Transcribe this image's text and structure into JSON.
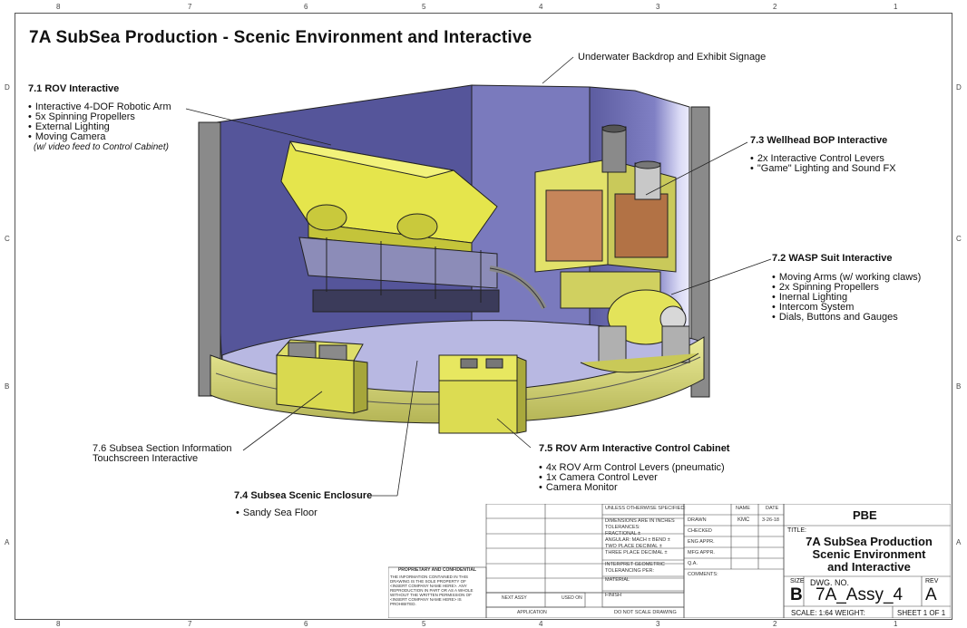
{
  "border": {
    "top_numbers": [
      "8",
      "7",
      "6",
      "5",
      "4",
      "3",
      "2",
      "1"
    ],
    "bottom_numbers": [
      "8",
      "7",
      "6",
      "5",
      "4",
      "3",
      "2",
      "1"
    ],
    "side_letters": [
      "D",
      "C",
      "B",
      "A"
    ]
  },
  "title": "7A SubSea Production - Scenic Environment and Interactive",
  "callouts": {
    "backdrop": {
      "label": "Underwater Backdrop and Exhibit Signage"
    },
    "rov": {
      "heading": "7.1  ROV Interactive",
      "items": [
        "Interactive 4-DOF Robotic Arm",
        "5x Spinning Propellers",
        "External Lighting",
        "Moving Camera"
      ],
      "note": "(w/ video feed to Control Cabinet)"
    },
    "wellhead": {
      "heading": "7.3  Wellhead BOP Interactive",
      "items": [
        "2x Interactive Control Levers",
        "\"Game\" Lighting and Sound FX"
      ]
    },
    "wasp": {
      "heading": "7.2  WASP Suit Interactive",
      "items": [
        "Moving Arms (w/ working claws)",
        "2x Spinning Propellers",
        "Inernal Lighting",
        "Intercom System",
        "Dials, Buttons and Gauges"
      ]
    },
    "touchscreen": {
      "line1": "7.6  Subsea Section Information",
      "line2": "Touchscreen Interactive"
    },
    "cabinet": {
      "heading": "7.5  ROV Arm Interactive Control Cabinet",
      "items": [
        "4x ROV Arm Control Levers (pneumatic)",
        "1x Camera Control Lever",
        "Camera Monitor"
      ]
    },
    "enclosure": {
      "heading": "7.4  Subsea Scenic Enclosure",
      "items": [
        "Sandy Sea Floor"
      ]
    }
  },
  "title_block": {
    "company": "PBE",
    "title_label": "TITLE:",
    "title_lines": [
      "7A SubSea Production",
      "Scenic Environment",
      "and Interactive"
    ],
    "size_label": "SIZE",
    "size": "B",
    "dwg_no_label": "DWG.  NO.",
    "dwg_no": "7A_Assy_4",
    "rev_label": "REV",
    "rev": "A",
    "scale": "SCALE: 1:64 WEIGHT:",
    "sheet": "SHEET 1 OF 1",
    "unless": "UNLESS OTHERWISE SPECIFIED:",
    "name_label": "NAME",
    "date_label": "DATE",
    "drawn_label": "DRAWN",
    "drawn_name": "KMC",
    "drawn_date": "3-26-18",
    "checked": "CHECKED",
    "eng_appr": "ENG APPR.",
    "mfg_appr": "MFG APPR.",
    "qa": "Q.A.",
    "comments": "COMMENTS:",
    "tolerances": [
      "DIMENSIONS ARE IN INCHES",
      "TOLERANCES:",
      "FRACTIONAL ±",
      "ANGULAR: MACH ±    BEND ±",
      "TWO PLACE DECIMAL    ±",
      "THREE PLACE DECIMAL  ±"
    ],
    "interpret": [
      "INTERPRET GEOMETRIC",
      "TOLERANCING PER:"
    ],
    "material": "MATERIAL",
    "finish": "FINISH",
    "next_assy": "NEXT ASSY",
    "used_on": "USED ON",
    "application": "APPLICATION",
    "do_not_scale": "DO NOT SCALE DRAWING",
    "proprietary_heading": "PROPRIETARY AND CONFIDENTIAL",
    "proprietary_text": [
      "THE INFORMATION CONTAINED IN THIS",
      "DRAWING IS THE SOLE PROPERTY OF",
      "<INSERT COMPANY NAME HERE>.  ANY",
      "REPRODUCTION IN PART OR AS A WHOLE",
      "WITHOUT THE WRITTEN PERMISSION OF",
      "<INSERT COMPANY NAME HERE> IS",
      "PROHIBITED."
    ]
  },
  "colors": {
    "backdrop": "#6f6fb0",
    "backdrop_light": "#c9c9ef",
    "floor": "#b9b9e2",
    "yellow": "#e6e64f",
    "yellow_dark": "#9c9c2e",
    "copper": "#c77b4d",
    "wall_post": "#8e8e8e"
  }
}
